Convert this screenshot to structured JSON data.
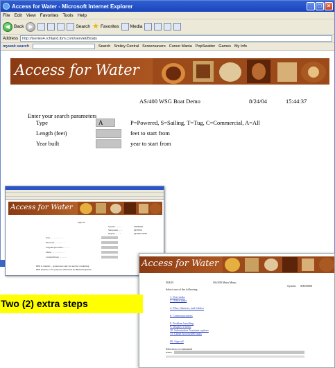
{
  "browser": {
    "window_title": "Access for Water - Microsoft Internet Explorer",
    "menu": [
      "File",
      "Edit",
      "View",
      "Favorites",
      "Tools",
      "Help"
    ],
    "toolbar": {
      "back": "Back",
      "search": "Search",
      "favorites": "Favorites",
      "media": "Media"
    },
    "address_label": "Address",
    "address_value": "http://iseries4.rchland.ibm.com/servlet/Boats",
    "links_logo": "myweb search",
    "links": [
      "Search",
      "Smiley Central",
      "Screensavers",
      "Cursor Mania",
      "PopSwatter",
      "Games",
      "My Info"
    ]
  },
  "page": {
    "banner_title": "Access for Water",
    "app_header": "AS/400 WSG Boat Demo",
    "date": "8/24/04",
    "time": "15:44:37",
    "prompt": "Enter your search parameters",
    "type_label": "Type",
    "type_value": "A",
    "type_help": "P=Powered, S=Sailing, T=Tug, C=Commercial, A=All",
    "length_label": "Length (feet)",
    "length_help": "feet to start from",
    "year_label": "Year built",
    "year_help": "year to start from"
  },
  "signon": {
    "banner_title": "Access for Water",
    "heading": "Sign On",
    "system_label": "System . . . . :",
    "system_value": "S0000000",
    "subsystem_label": "Subsystem . . . :",
    "subsystem_value": "QINTER",
    "display_label": "Display . . . . :",
    "display_value": "QPADEV000F",
    "user_label": "User . . . . . . . . . . . .",
    "password_label": "Password . . . . . . . . . .",
    "program_label": "Program/procedure . . . . . .",
    "menu_label": "Menu . . . . . . . . . . . .",
    "library_label": "Current library . . . . . . .",
    "footer1": "IBM is claimed ... system used only for used for conducting",
    "footer2": "IBM business or for purposes authorized by IBM management"
  },
  "mainmenu": {
    "banner_title": "Access for Water",
    "menu_name": "MAIN",
    "title": "OS/400 Main Menu",
    "system_label": "System:",
    "system_value": "S0000000",
    "select_prompt": "Select one of the following:",
    "options": [
      "1. User tasks",
      "2. Office tasks",
      "4. Files, libraries, and folders",
      "6. Communications",
      "8. Problem handling",
      "9. Display a menu",
      "10. Information Assistant options",
      "11. Client Access/400 tasks",
      "90. Sign off"
    ],
    "selection_label": "Selection or command",
    "command_prompt": "===>"
  },
  "callout": {
    "text": "Two (2) extra steps"
  },
  "colors": {
    "banner": "#a8521f",
    "callout": "#ffff00",
    "titlebar": "#2f5fd6"
  }
}
